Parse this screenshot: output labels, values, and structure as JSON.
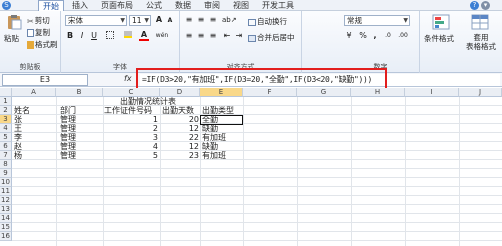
{
  "menu": {
    "file_badge": "S",
    "tabs": [
      "开始",
      "插入",
      "页面布局",
      "公式",
      "数据",
      "审阅",
      "视图",
      "开发工具"
    ]
  },
  "ribbon": {
    "clipboard": {
      "paste": "粘贴",
      "cut": "剪切",
      "copy": "复制",
      "format_painter": "格式刷",
      "label": "剪贴板"
    },
    "font": {
      "name": "宋体",
      "size": "11",
      "bold": "B",
      "italic": "I",
      "underline": "U",
      "label": "字体",
      "grow": "A",
      "shrink": "A",
      "color_a": "A",
      "wen": "wén"
    },
    "alignment": {
      "wrap": "自动换行",
      "merge": "合并后居中",
      "label": "对齐方式"
    },
    "number": {
      "format": "常规",
      "percent": "%",
      "comma": ",",
      "inc": ".0",
      "dec": ".00",
      "label": "数字"
    },
    "styles": {
      "conditional": "条件格式",
      "table": "套用\n表格格式"
    }
  },
  "formula_bar": {
    "name_box": "E3",
    "fx": "fx",
    "formula": "=IF(D3>20,\"有加班\",IF(D3=20,\"全勤\",IF(D3<20,\"缺勤\")))"
  },
  "grid": {
    "columns": [
      "A",
      "B",
      "C",
      "D",
      "E",
      "F",
      "G",
      "H",
      "I",
      "J"
    ],
    "selected_column": "E",
    "rows": [
      "1",
      "2",
      "3",
      "4",
      "5",
      "6",
      "7",
      "8",
      "9",
      "10",
      "11",
      "12",
      "13",
      "14",
      "15",
      "16"
    ],
    "selected_row": "3",
    "title": "出勤情况统计表",
    "headers": [
      "姓名",
      "部门",
      "工作证件号码",
      "出勤天数",
      "出勤类型"
    ],
    "records": [
      [
        "张",
        "管理",
        "1",
        "20",
        "全勤"
      ],
      [
        "王",
        "管理",
        "2",
        "12",
        "缺勤"
      ],
      [
        "李",
        "管理",
        "3",
        "22",
        "有加班"
      ],
      [
        "赵",
        "管理",
        "4",
        "12",
        "缺勤"
      ],
      [
        "杨",
        "管理",
        "5",
        "23",
        "有加班"
      ]
    ]
  },
  "colors": {
    "highlight": "#e21d1d",
    "selected_header": "#f9d889"
  }
}
